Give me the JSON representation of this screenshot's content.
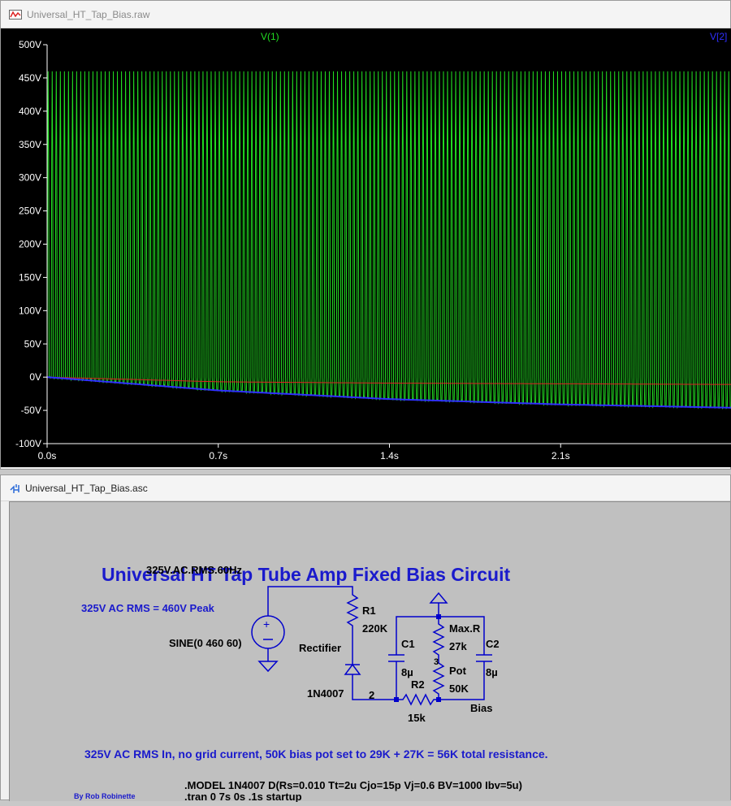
{
  "waveform_window": {
    "title": "Universal_HT_Tap_Bias.raw",
    "icon": "waveform-icon",
    "trace_labels": {
      "v1": "V(1)",
      "v2": "V[2]"
    },
    "colors": {
      "v1": "#22dd22",
      "v2": "#2f2fff",
      "red": "#dd2222",
      "bg": "#000000",
      "axis": "#ffffff"
    },
    "y_ticks": [
      "500V",
      "450V",
      "400V",
      "350V",
      "300V",
      "250V",
      "200V",
      "150V",
      "100V",
      "50V",
      "0V",
      "-50V",
      "-100V"
    ],
    "x_ticks": [
      "0.0s",
      "0.7s",
      "1.4s",
      "2.1s"
    ]
  },
  "chart_data": {
    "type": "line",
    "xlabel": "",
    "ylabel": "",
    "xlim": [
      0,
      2.8
    ],
    "ylim": [
      -100,
      500
    ],
    "series": [
      {
        "name": "V(1)",
        "description": "60 Hz sine, peak 460V, rectified envelope, min follows bias",
        "peak": 460,
        "frequency_hz": 60
      },
      {
        "name": "V[2]",
        "x": [
          0,
          0.7,
          1.4,
          2.1,
          2.8
        ],
        "values": [
          0,
          -20,
          -33,
          -41,
          -46
        ]
      },
      {
        "x": [
          0,
          0.7,
          1.4,
          2.8
        ],
        "values": [
          0,
          -7,
          -9,
          -11
        ]
      }
    ]
  },
  "schematic_window": {
    "title": "Universal_HT_Tap_Bias.asc",
    "icon": "schematic-icon",
    "heading": "Universal HT Tap Tube Amp Fixed Bias Circuit",
    "source_label": "325V.AC.RMS.60Hz",
    "source_note": "325V AC RMS = 460V Peak",
    "sine_spec": "SINE(0 460 60)",
    "rectifier_label": "Rectifier",
    "diode_model": "1N4007",
    "node_2": "2",
    "r1_name": "R1",
    "r1_value": "220K",
    "c1_name": "C1",
    "c1_value": "8µ",
    "r2_name": "R2",
    "r2_value": "15k",
    "maxr_name": "Max.R",
    "maxr_value": "27k",
    "pot_name": "Pot",
    "pot_value": "50K",
    "pot_pin": "3",
    "c2_name": "C2",
    "c2_value": "8µ",
    "bias_label": "Bias",
    "description": "325V AC RMS In, no grid current, 50K bias pot set to 29K + 27K = 56K total resistance.",
    "model_directive": ".MODEL 1N4007 D(Rs=0.010 Tt=2u Cjo=15p Vj=0.6 BV=1000 Ibv=5u)",
    "tran_directive": ".tran 0 7s 0s .1s startup",
    "author": "By Rob Robinette",
    "colors": {
      "wire": "#0000cc",
      "heading": "#1a1acc",
      "note": "#1a1acc",
      "label": "#000000"
    }
  }
}
